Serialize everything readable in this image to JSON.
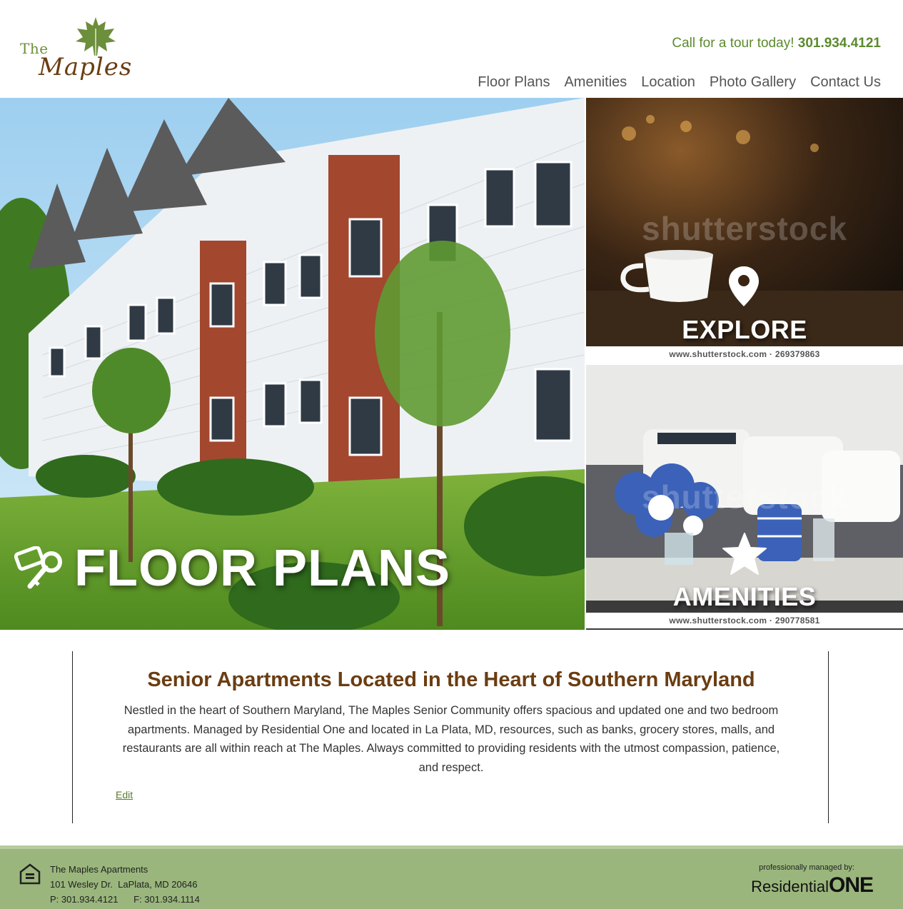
{
  "header": {
    "logo": {
      "the": "The",
      "maples": "Maples"
    },
    "phone_prefix": "Call for a tour today!",
    "phone_number": "301.934.4121",
    "nav": [
      {
        "label": "Floor Plans"
      },
      {
        "label": "Amenities"
      },
      {
        "label": "Location"
      },
      {
        "label": "Photo Gallery"
      },
      {
        "label": "Contact Us"
      }
    ]
  },
  "hero": {
    "main_label": "FLOOR PLANS",
    "tiles": [
      {
        "label": "EXPLORE",
        "watermark": "shutterstock",
        "credit": "www.shutterstock.com · 269379863",
        "icon": "map-pin-icon"
      },
      {
        "label": "AMENITIES",
        "watermark": "shutterstock",
        "credit": "www.shutterstock.com · 290778581",
        "icon": "star-icon"
      }
    ],
    "main_icon": "key-tag-icon"
  },
  "content": {
    "title": "Senior Apartments Located in the Heart of Southern Maryland",
    "body": "Nestled in the heart of Southern Maryland, The Maples Senior Community offers spacious and updated one and two bedroom apartments. Managed by Residential One and located in La Plata, MD, resources, such as banks, grocery stores, malls, and restaurants are all within reach at The Maples. Always committed to providing residents with the utmost compassion, patience, and respect.",
    "edit_label": "Edit"
  },
  "footer": {
    "name": "The Maples Apartments",
    "address": "101 Wesley Dr.  LaPlata, MD 20646",
    "phones": "P: 301.934.4121      F: 301.934.1114",
    "managed_by": "professionally managed by:",
    "brand_a": "Residential",
    "brand_b": "ONE",
    "icon": "equal-housing-icon"
  },
  "colors": {
    "accent_green": "#5c8a2e",
    "brown": "#6a3d12",
    "footer_bg": "#9ab67d"
  }
}
